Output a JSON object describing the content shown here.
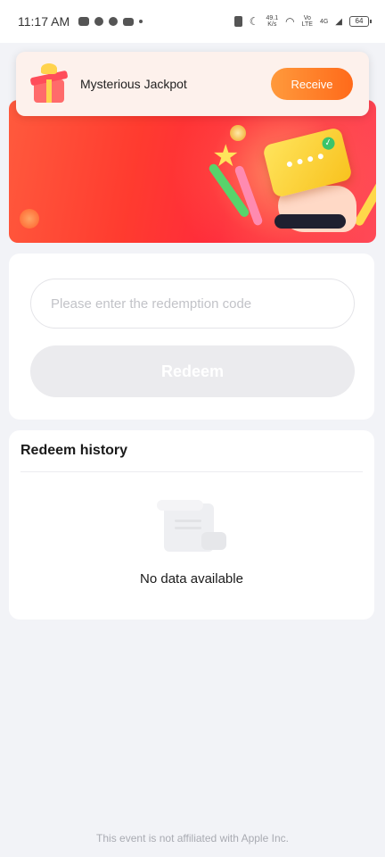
{
  "status_bar": {
    "time": "11:17 AM",
    "network_speed": "49.1\nK/s",
    "carrier_tag": "Vo\nLTE",
    "network_type": "4G",
    "battery": "64"
  },
  "notification": {
    "title": "Mysterious Jackpot",
    "button_label": "Receive",
    "button_colors": [
      "#ff9a3c",
      "#ff6a1a"
    ]
  },
  "redeem": {
    "placeholder": "Please enter the redemption code",
    "value": "",
    "button_label": "Redeem"
  },
  "history": {
    "title": "Redeem history",
    "empty_text": "No data available"
  },
  "footer": {
    "note": "This event is not affiliated with Apple Inc."
  },
  "colors": {
    "background": "#f2f3f7",
    "banner_accent": "#ff3b2f"
  }
}
